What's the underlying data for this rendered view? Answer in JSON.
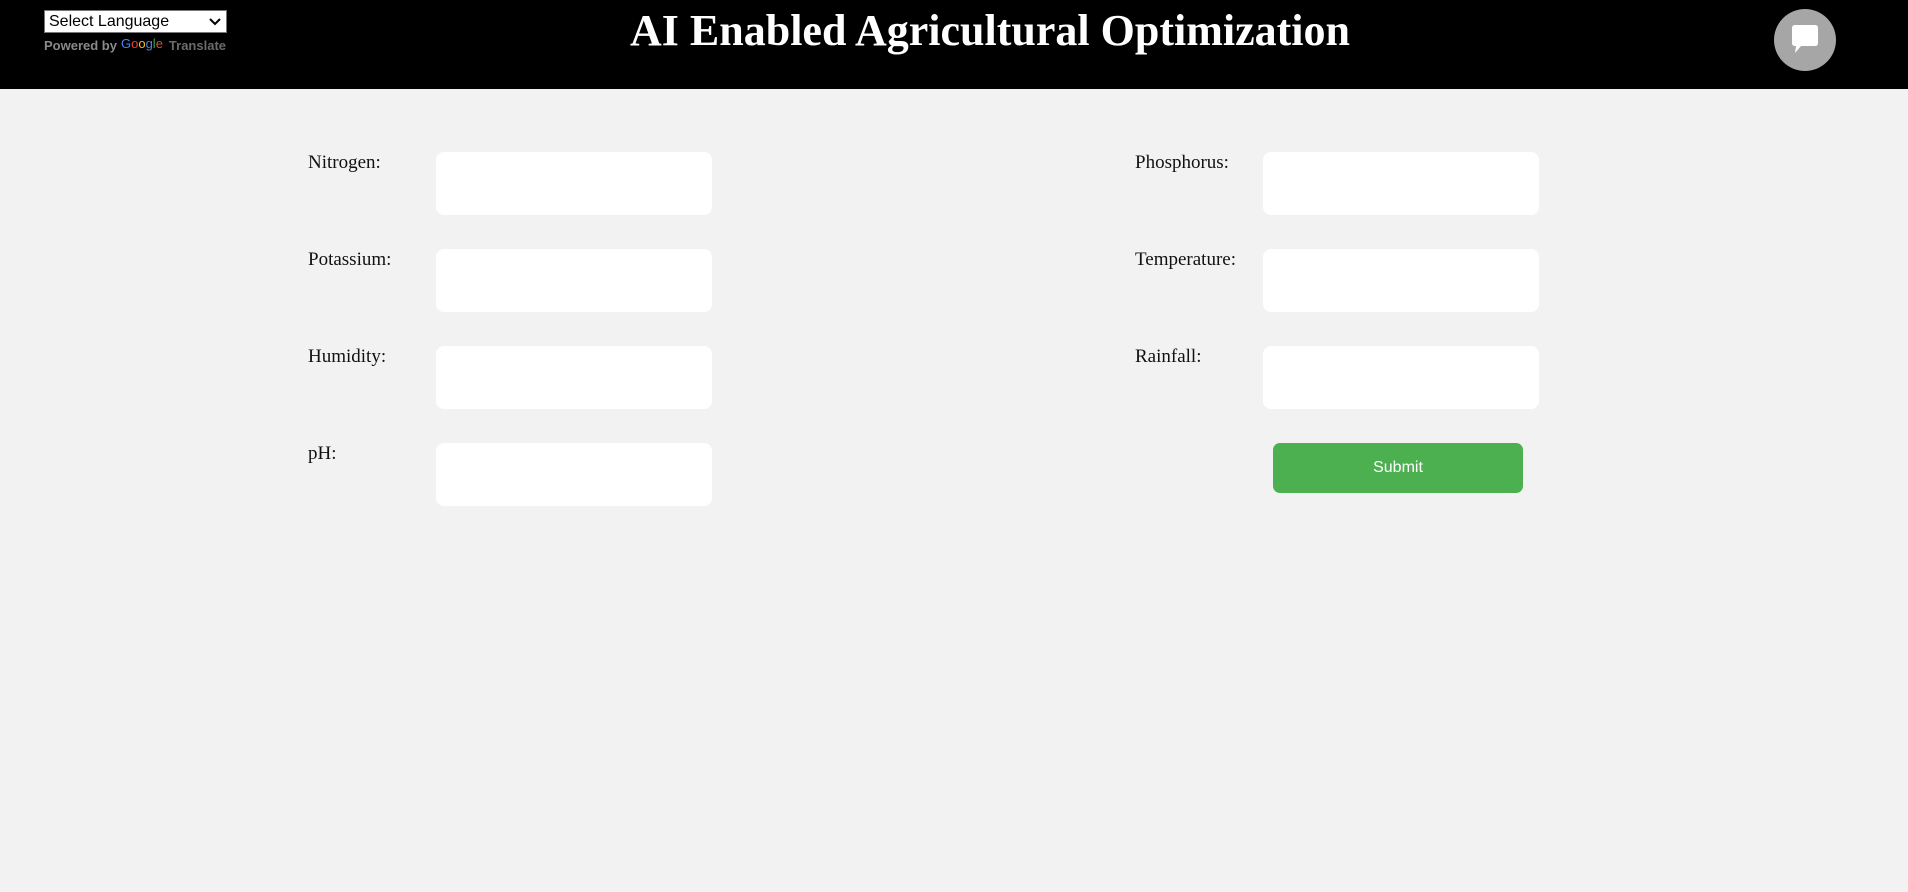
{
  "header": {
    "title": "AI Enabled Agricultural Optimization",
    "language_select": {
      "selected": "Select Language"
    },
    "powered_by": {
      "prefix": "Powered by",
      "brand_letters": [
        "G",
        "o",
        "o",
        "g",
        "l",
        "e"
      ],
      "suffix": "Translate"
    },
    "chat_icon": "chat-bubble-icon"
  },
  "form": {
    "fields": {
      "nitrogen": {
        "label": "Nitrogen:",
        "value": ""
      },
      "phosphorus": {
        "label": "Phosphorus:",
        "value": ""
      },
      "potassium": {
        "label": "Potassium:",
        "value": ""
      },
      "temperature": {
        "label": "Temperature:",
        "value": ""
      },
      "humidity": {
        "label": "Humidity:",
        "value": ""
      },
      "rainfall": {
        "label": "Rainfall:",
        "value": ""
      },
      "ph": {
        "label": "pH:",
        "value": ""
      }
    },
    "submit_label": "Submit"
  },
  "colors": {
    "header_bg": "#000000",
    "page_bg": "#f2f2f2",
    "submit_bg": "#4caf50",
    "chat_button_bg": "#a6a6a6"
  }
}
